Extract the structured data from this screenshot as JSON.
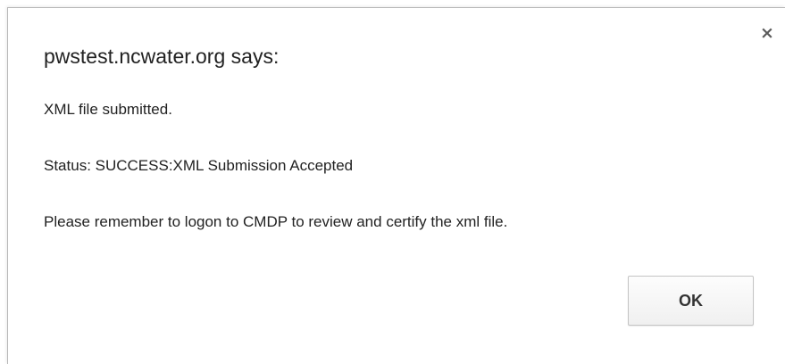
{
  "dialog": {
    "title": "pwstest.ncwater.org says:",
    "close_glyph": "×",
    "close_icon": "close-icon",
    "messages": [
      "XML file submitted.",
      "Status: SUCCESS:XML Submission Accepted",
      "Please remember to logon to CMDP to review and certify the xml file."
    ],
    "ok_label": "OK"
  }
}
